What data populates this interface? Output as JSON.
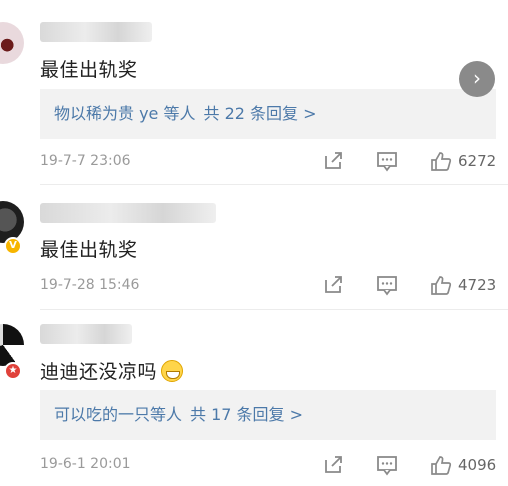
{
  "comments": [
    {
      "text": "最佳出轨奖",
      "reply_preview": {
        "users": "物以稀为贵 ye 等人",
        "count": "共 22 条回复 >"
      },
      "timestamp": "19-7-7 23:06",
      "likes": "6272",
      "badge": ""
    },
    {
      "text": "最佳出轨奖",
      "timestamp": "19-7-28 15:46",
      "likes": "4723",
      "badge": "V"
    },
    {
      "text": "迪迪还没凉吗",
      "reply_preview": {
        "users": "可以吃的一只等人",
        "count": "共 17 条回复 >"
      },
      "timestamp": "19-6-1 20:01",
      "likes": "4096",
      "badge": ""
    }
  ],
  "icons": {
    "share": "share-icon",
    "comment": "comment-icon",
    "like": "thumbs-up-icon",
    "next": "chevron-right-icon"
  },
  "colors": {
    "reply_link": "#4c79a9",
    "reply_bg": "#f2f2f2",
    "meta_text": "#9a9a9a",
    "verified_badge": "#f7b500",
    "red_badge": "#e0413a"
  }
}
